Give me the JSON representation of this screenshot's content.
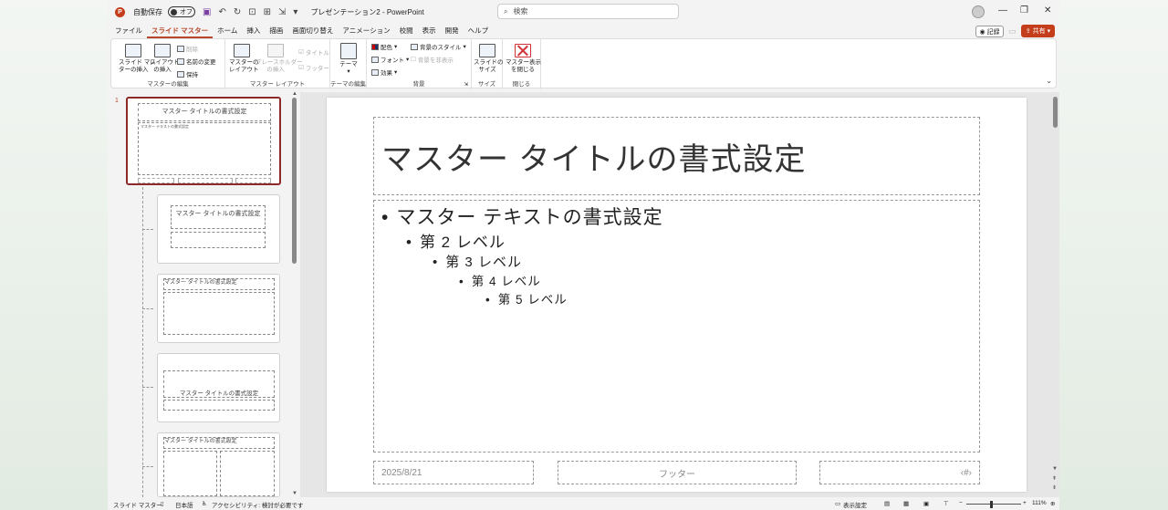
{
  "titlebar": {
    "autosave_label": "自動保存",
    "autosave_state": "オフ",
    "document_title": "プレゼンテーション2 - PowerPoint",
    "search_placeholder": "検索",
    "logo_letter": "P"
  },
  "tabs": [
    "ファイル",
    "スライド マスター",
    "ホーム",
    "挿入",
    "描画",
    "画面切り替え",
    "アニメーション",
    "校閲",
    "表示",
    "開発",
    "ヘルプ"
  ],
  "active_tab": 1,
  "actions": {
    "record_label": "記録",
    "share_label": "共有"
  },
  "ribbon": {
    "edit_master": {
      "label": "マスターの編集",
      "insert_slide_master": "スライド マス\nターの挿入",
      "insert_layout": "レイアウト\nの挿入",
      "delete": "削除",
      "rename": "名前の変更",
      "preserve": "保持"
    },
    "master_layout": {
      "label": "マスター レイアウト",
      "master_layout_btn": "マスターの\nレイアウト",
      "insert_placeholder": "プレースホルダー\nの挿入",
      "title_check": "タイトル",
      "footer_check": "フッター"
    },
    "edit_theme": {
      "label": "テーマの編集",
      "themes": "テーマ"
    },
    "background": {
      "label": "背景",
      "colors": "配色",
      "fonts": "フォント",
      "effects": "効果",
      "bg_styles": "背景のスタイル",
      "hide_bg": "背景を非表示"
    },
    "size": {
      "label": "サイズ",
      "slide_size": "スライドの\nサイズ"
    },
    "close": {
      "label": "閉じる",
      "close_master": "マスター表示\nを閉じる"
    }
  },
  "thumbnails": {
    "slide_number": "1",
    "master_title": "マスター タイトルの書式設定",
    "master_body": "マスター テキストの書式設定",
    "layout_title_2": "マスター タイトルの書式設定",
    "layout_title_3": "マスター タイトルの書式設定",
    "layout_title_4": "マスター タイトルの書式設定",
    "layout_title_5": "マスター タイトルの書式設定"
  },
  "slide": {
    "title": "マスター タイトルの書式設定",
    "bullets": [
      {
        "level": 1,
        "text": "マスター テキストの書式設定"
      },
      {
        "level": 2,
        "text": "第 2 レベル"
      },
      {
        "level": 3,
        "text": "第 3 レベル"
      },
      {
        "level": 4,
        "text": "第 4 レベル"
      },
      {
        "level": 5,
        "text": "第 5 レベル"
      }
    ],
    "date": "2025/8/21",
    "footer": "フッター",
    "slide_number": "‹#›"
  },
  "statusbar": {
    "view": "スライド マスター",
    "language": "日本語",
    "accessibility": "アクセシビリティ: 検討が必要です",
    "display_settings": "表示設定",
    "zoom": "111%"
  },
  "colors": {
    "accent": "#b7472a",
    "share": "#c43e1c"
  }
}
